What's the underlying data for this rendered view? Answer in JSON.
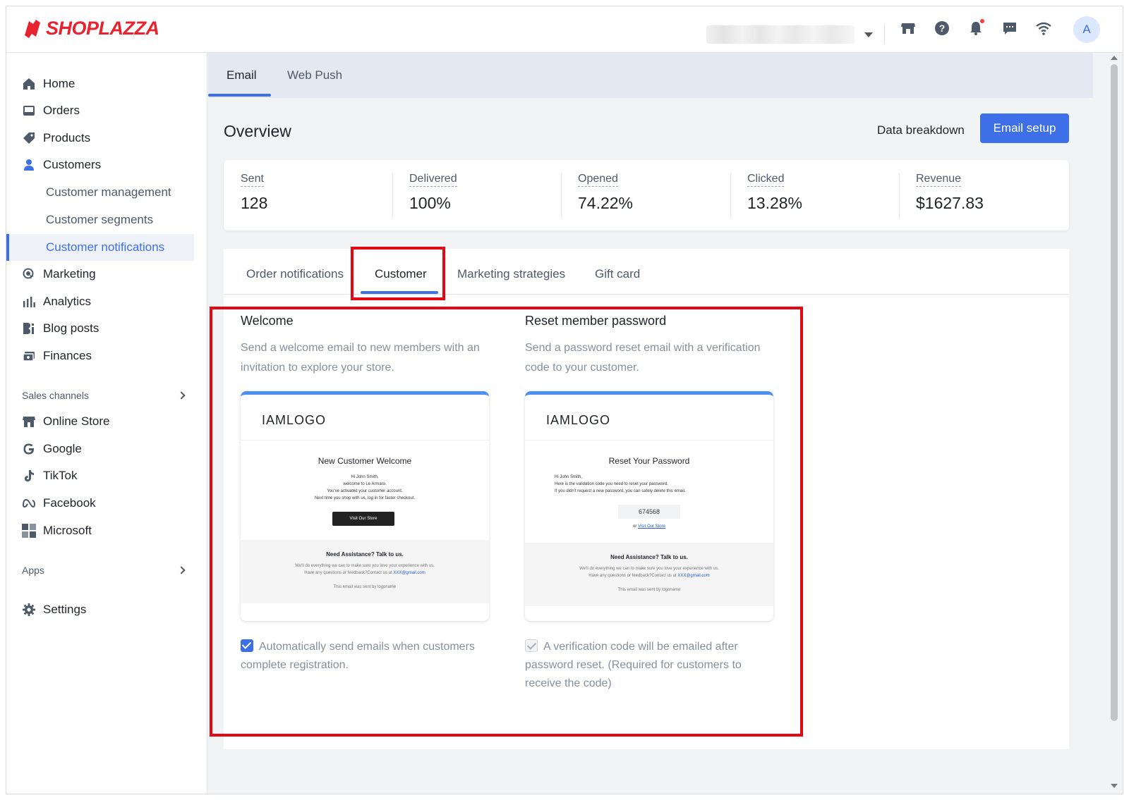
{
  "brand": {
    "name": "SHOPLAZZA",
    "color": "#e8232f"
  },
  "header": {
    "icons": [
      "store-icon",
      "help-icon",
      "bell-icon",
      "message-icon",
      "wifi-icon"
    ],
    "avatar_initial": "A"
  },
  "sidebar": {
    "items": [
      {
        "label": "Home",
        "icon": "home-icon"
      },
      {
        "label": "Orders",
        "icon": "orders-icon"
      },
      {
        "label": "Products",
        "icon": "tag-icon"
      },
      {
        "label": "Customers",
        "icon": "person-icon"
      }
    ],
    "customer_sub": [
      "Customer management",
      "Customer segments",
      "Customer notifications"
    ],
    "items2": [
      {
        "label": "Marketing",
        "icon": "marketing-icon"
      },
      {
        "label": "Analytics",
        "icon": "analytics-icon"
      },
      {
        "label": "Blog posts",
        "icon": "blog-icon"
      },
      {
        "label": "Finances",
        "icon": "finance-icon"
      }
    ],
    "sales_channels_label": "Sales channels",
    "channels": [
      {
        "label": "Online Store",
        "icon": "store-icon"
      },
      {
        "label": "Google",
        "icon": "google-icon"
      },
      {
        "label": "TikTok",
        "icon": "tiktok-icon"
      },
      {
        "label": "Facebook",
        "icon": "meta-icon"
      },
      {
        "label": "Microsoft",
        "icon": "microsoft-icon"
      }
    ],
    "apps_label": "Apps",
    "settings_label": "Settings"
  },
  "main": {
    "top_tabs": [
      "Email",
      "Web Push"
    ],
    "overview_title": "Overview",
    "data_breakdown": "Data breakdown",
    "email_setup": "Email setup",
    "stats": [
      {
        "label": "Sent",
        "value": "128"
      },
      {
        "label": "Delivered",
        "value": "100%"
      },
      {
        "label": "Opened",
        "value": "74.22%"
      },
      {
        "label": "Clicked",
        "value": "13.28%"
      },
      {
        "label": "Revenue",
        "value": "$1627.83"
      }
    ],
    "content_tabs": [
      "Order notifications",
      "Customer",
      "Marketing strategies",
      "Gift card"
    ],
    "templates": {
      "welcome": {
        "title": "Welcome",
        "desc": "Send a welcome email to new members with an invitation to explore your store.",
        "preview": {
          "logo": "IAMLOGO",
          "heading": "New Customer Welcome",
          "lines": [
            "Hi  John Smith,",
            "welcome to Le Armaro.",
            "You've activated your customer account.",
            "Next time you shop with us, log in for faster checkout."
          ],
          "button": "Visit Our Store",
          "footer_title": "Need Assistance? Talk to us.",
          "footer_line1": "We'll do everything we can to make sure you love your experience with us.",
          "footer_line2": "Have any questions or feedback?Contact us at",
          "footer_email": "XXX@gmail.com",
          "footer_sent": "This email was sent by logoname"
        },
        "option": "Automatically send emails when customers complete registration."
      },
      "reset": {
        "title": "Reset member password",
        "desc": "Send a password reset email with a verification code to your customer.",
        "preview": {
          "logo": "IAMLOGO",
          "heading": "Reset Your Password",
          "lines": [
            "Hi  John Smith,",
            "Here is the validation code you need to reset your password.",
            "If you didn't request a new password, you can safely delete this email."
          ],
          "code": "674568",
          "or": "or",
          "link": "Visit Our Store",
          "footer_title": "Need Assistance? Talk to us.",
          "footer_line1": "We'll do everything we can to make sure you love your experience with us.",
          "footer_line2": "Have any questions or feedback?Contact us at",
          "footer_email": "XXX@gmail.com",
          "footer_sent": "This email was sent by logoname"
        },
        "option": "A verification code will be emailed after password reset. (Required for customers to receive the code)"
      }
    }
  },
  "colors": {
    "accent": "#3d6fe8",
    "highlight_box": "#e30613",
    "preview_top": "#4d8ff0"
  }
}
